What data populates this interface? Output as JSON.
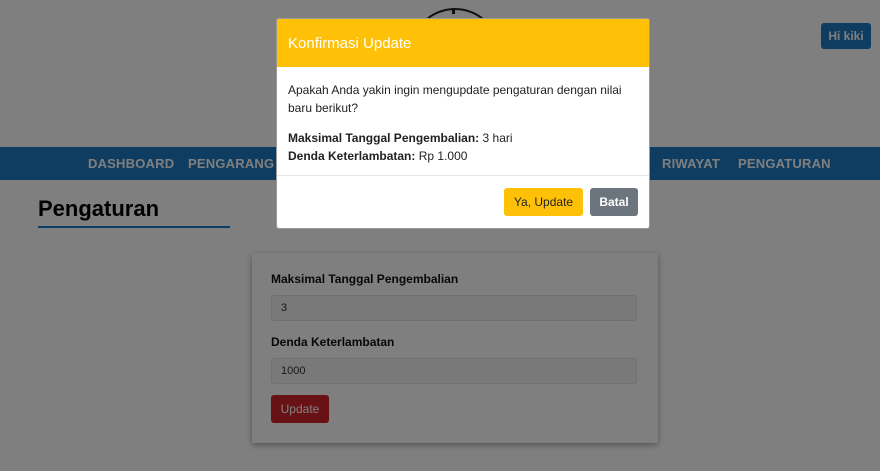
{
  "header": {
    "user_button": "Hi kiki"
  },
  "nav": {
    "items": [
      "DASHBOARD",
      "PENGARANG",
      "RIWAYAT",
      "PENGATURAN"
    ]
  },
  "page": {
    "title": "Pengaturan"
  },
  "form": {
    "max_days_label": "Maksimal Tanggal Pengembalian",
    "max_days_value": "3",
    "fine_label": "Denda Keterlambatan",
    "fine_value": "1000",
    "submit_label": "Update"
  },
  "modal": {
    "title": "Konfirmasi Update",
    "question": "Apakah Anda yakin ingin mengupdate pengaturan dengan nilai baru berikut?",
    "max_days_label": "Maksimal Tanggal Pengembalian:",
    "max_days_value": "3 hari",
    "fine_label": "Denda Keterlambatan:",
    "fine_value": "Rp 1.000",
    "confirm_label": "Ya, Update",
    "cancel_label": "Batal"
  },
  "colors": {
    "primary": "#1f7bc2",
    "warning": "#ffc107",
    "danger": "#d0242b",
    "secondary": "#6c757d"
  }
}
